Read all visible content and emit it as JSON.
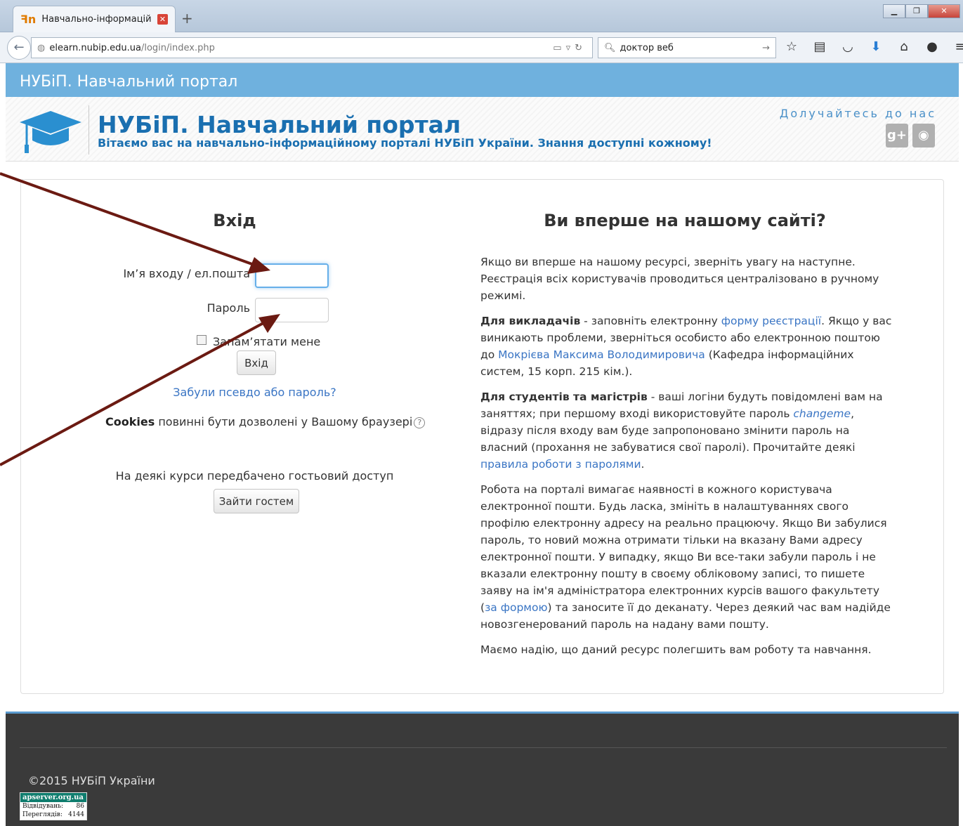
{
  "browser": {
    "tab_title": "Навчально-інформаційн...",
    "new_tab": "+",
    "url_domain": "elearn.nubip.edu.ua",
    "url_path": "/login/index.php",
    "search_value": "доктор веб",
    "icons": [
      "star-icon",
      "reading-list-icon",
      "pocket-icon",
      "download-icon",
      "home-icon",
      "chat-icon",
      "menu-icon"
    ]
  },
  "site": {
    "bar_title": "НУБіП. Навчальний портал",
    "title": "НУБіП. Навчальний портал",
    "tagline": "Вітаємо вас на навчально-інформаційному порталі НУБіП України. Знання доступні кожному!",
    "join": "Долучайтесь до нас",
    "social": [
      "g+",
      "g"
    ],
    "brand_color": "#1a6fb0",
    "bar_color": "#6fb1de"
  },
  "login": {
    "title": "Вхід",
    "username_label": "Ім’я входу / ел.пошта",
    "password_label": "Пароль",
    "remember_label": "Запам’ятати мене",
    "submit_label": "Вхід",
    "forgot_link": "Забули псевдо або пароль?",
    "cookies_bold": "Cookies",
    "cookies_text": " повинні бути дозволені у Вашому браузері",
    "guest_note": "На деякі курси передбачено гостьовий доступ",
    "guest_button": "Зайти гостем"
  },
  "info": {
    "title": "Ви вперше на нашому сайті?",
    "p1": "Якщо ви вперше на нашому ресурсі, зверніть увагу на наступне. Реєстрація всіх користувачів проводиться централізовано в ручному режимі.",
    "p2_bold": "Для викладачів",
    "p2_a": " - заповніть електронну ",
    "p2_link1": "форму реєстрації",
    "p2_b": ". Якщо у вас виникають проблеми, зверніться особисто або електронною поштою до ",
    "p2_link2": "Мокрієва Максима Володимировича",
    "p2_c": " (Кафедра інформаційних систем, 15 корп. 215 кім.).",
    "p3_bold": "Для студентів та магістрів",
    "p3_a": " - ваші логіни будуть повідомлені вам на заняттях; при першому вході використовуйте пароль ",
    "p3_italic": "changeme",
    "p3_b": ", відразу після входу вам буде запропоновано змінити пароль на власний (прохання не забуватися свої паролі). Прочитайте деякі ",
    "p3_link": "правила роботи з паролями",
    "p3_c": ".",
    "p4_a": "Робота на порталі вимагає наявності в кожного користувача електронної пошти. Будь ласка, змініть в налаштуваннях свого профілю електронну адресу на реально працюючу. Якщо Ви забулися пароль, то новий можна отримати тільки на вказану Вами адресу електронної пошти. У випадку, якщо Ви все-таки забули пароль і не вказали електронну пошту в своєму обліковому записі, то пишете заяву на ім'я адміністратора електронних курсів вашого факультету  (",
    "p4_link": "за формою",
    "p4_b": ") та заносите її до деканату. Через деякий час вам надійде новозгенерований пароль на надану вами пошту.",
    "p5": "Маємо надію, що даний ресурс полегшить вам роботу та навчання."
  },
  "footer": {
    "copyright": "©2015 НУБіП України",
    "counter_head": "apserver.org.ua",
    "counter_rows": [
      {
        "label": "Відвідувань:",
        "value": "86"
      },
      {
        "label": "Переглядів:",
        "value": "4144"
      }
    ]
  },
  "annotation_color": "#6b1a12"
}
